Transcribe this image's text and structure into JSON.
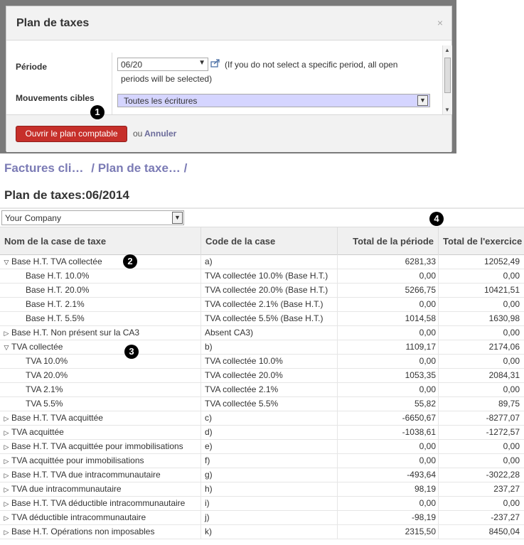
{
  "dialog": {
    "title": "Plan de taxes",
    "close_glyph": "×",
    "period_label": "Période",
    "period_value": "06/20",
    "period_hint_line1": "(If you do not select a specific period, all open",
    "period_hint_line2": "periods will be selected)",
    "target_label": "Mouvements cibles",
    "target_value": "Toutes les écritures",
    "open_button": "Ouvrir le plan comptable",
    "or_text": "ou",
    "cancel_link": "Annuler"
  },
  "callouts": [
    "1",
    "2",
    "3",
    "4"
  ],
  "breadcrumb": {
    "crumb1": "Factures cli…",
    "crumb2": "Plan de taxe…",
    "separator": "/"
  },
  "page_title": "Plan de taxes:06/2014",
  "company_select": "Your Company",
  "grid": {
    "headers": {
      "name": "Nom de la case de taxe",
      "code": "Code de la case",
      "period": "Total de la période",
      "year": "Total de l'exercice"
    },
    "rows": [
      {
        "level": 0,
        "toggle": "expanded",
        "name": "Base H.T. TVA collectée",
        "code": "a)",
        "period": "6281,33",
        "year": "12052,49"
      },
      {
        "level": 1,
        "toggle": "none",
        "name": "Base H.T. 10.0%",
        "code": "TVA collectée 10.0% (Base H.T.)",
        "period": "0,00",
        "year": "0,00"
      },
      {
        "level": 1,
        "toggle": "none",
        "name": "Base H.T. 20.0%",
        "code": "TVA collectée 20.0% (Base H.T.)",
        "period": "5266,75",
        "year": "10421,51"
      },
      {
        "level": 1,
        "toggle": "none",
        "name": "Base H.T. 2.1%",
        "code": "TVA collectée 2.1% (Base H.T.)",
        "period": "0,00",
        "year": "0,00"
      },
      {
        "level": 1,
        "toggle": "none",
        "name": "Base H.T. 5.5%",
        "code": "TVA collectée 5.5% (Base H.T.)",
        "period": "1014,58",
        "year": "1630,98"
      },
      {
        "level": 0,
        "toggle": "collapsed",
        "name": "Base H.T. Non présent sur la CA3",
        "code": "Absent CA3)",
        "period": "0,00",
        "year": "0,00"
      },
      {
        "level": 0,
        "toggle": "expanded",
        "name": "TVA collectée",
        "code": "b)",
        "period": "1109,17",
        "year": "2174,06"
      },
      {
        "level": 1,
        "toggle": "none",
        "name": "TVA 10.0%",
        "code": "TVA collectée 10.0%",
        "period": "0,00",
        "year": "0,00"
      },
      {
        "level": 1,
        "toggle": "none",
        "name": "TVA 20.0%",
        "code": "TVA collectée 20.0%",
        "period": "1053,35",
        "year": "2084,31"
      },
      {
        "level": 1,
        "toggle": "none",
        "name": "TVA 2.1%",
        "code": "TVA collectée 2.1%",
        "period": "0,00",
        "year": "0,00"
      },
      {
        "level": 1,
        "toggle": "none",
        "name": "TVA 5.5%",
        "code": "TVA collectée 5.5%",
        "period": "55,82",
        "year": "89,75"
      },
      {
        "level": 0,
        "toggle": "collapsed",
        "name": "Base H.T. TVA acquittée",
        "code": "c)",
        "period": "-6650,67",
        "year": "-8277,07"
      },
      {
        "level": 0,
        "toggle": "collapsed",
        "name": "TVA acquittée",
        "code": "d)",
        "period": "-1038,61",
        "year": "-1272,57"
      },
      {
        "level": 0,
        "toggle": "collapsed",
        "name": "Base H.T. TVA acquittée pour immobilisations",
        "code": "e)",
        "period": "0,00",
        "year": "0,00"
      },
      {
        "level": 0,
        "toggle": "collapsed",
        "name": "TVA acquittée pour immobilisations",
        "code": "f)",
        "period": "0,00",
        "year": "0,00"
      },
      {
        "level": 0,
        "toggle": "collapsed",
        "name": "Base H.T. TVA due intracommunautaire",
        "code": "g)",
        "period": "-493,64",
        "year": "-3022,28"
      },
      {
        "level": 0,
        "toggle": "collapsed",
        "name": "TVA due intracommunautaire",
        "code": "h)",
        "period": "98,19",
        "year": "237,27"
      },
      {
        "level": 0,
        "toggle": "collapsed",
        "name": "Base H.T. TVA déductible intracommunautaire",
        "code": "i)",
        "period": "0,00",
        "year": "0,00"
      },
      {
        "level": 0,
        "toggle": "collapsed",
        "name": "TVA déductible intracommunautaire",
        "code": "j)",
        "period": "-98,19",
        "year": "-237,27"
      },
      {
        "level": 0,
        "toggle": "collapsed",
        "name": "Base H.T. Opérations non imposables",
        "code": "k)",
        "period": "2315,50",
        "year": "8450,04"
      }
    ]
  }
}
